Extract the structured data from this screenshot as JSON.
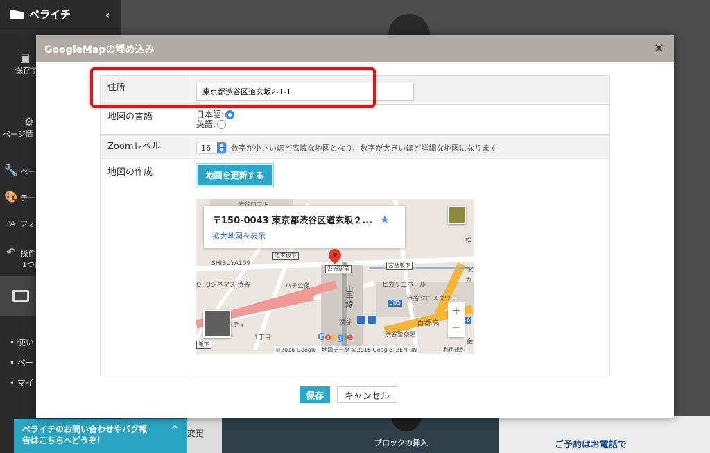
{
  "app": {
    "brand": "ペライチ",
    "sidebar": {
      "save_label": "保存す",
      "page_info_label": "ページ情",
      "page_label": "ペー",
      "theme_label": "テー",
      "font_label": "フォ",
      "undo_label": "操作",
      "undo_sub": "1つ戻",
      "bullets": [
        "使い",
        "ペー",
        "マイ"
      ]
    },
    "bottom": {
      "change_label": "変更",
      "block_insert": "ブロックの挿入",
      "reserve_text": "ご予約はお電話で"
    },
    "support": {
      "line1": "ペライチのお問い合わせやバグ報",
      "line2": "告はこちらへどうぞ！"
    }
  },
  "modal": {
    "title": "GoogleMapの埋め込み",
    "close_icon": "×",
    "address": {
      "label": "住所",
      "value": "東京都渋谷区道玄坂2-1-1"
    },
    "language": {
      "label": "地図の言語",
      "options": [
        {
          "label": "日本語:",
          "selected": true
        },
        {
          "label": "英語:",
          "selected": false
        }
      ]
    },
    "zoom": {
      "label": "Zoomレベル",
      "value": "16",
      "note": "数字が小さいほど広域な地図となり、数字が大きいほど詳細な地図になります"
    },
    "map_create": {
      "label": "地図の作成",
      "update_button": "地図を更新する"
    },
    "map": {
      "info_title": "〒150-0043 東京都渋谷区道玄坂２...",
      "info_link": "拡大地図を表示",
      "labels": {
        "shibuya": "渋谷",
        "shibuya109": "SHIBUYA109",
        "dogenzaka": "道玄坂下",
        "shibuya_station": "渋谷駅前",
        "miyamasuzaka": "宮益坂下",
        "hikarie": "ヒカリエホール",
        "cinema": "OHOシネマズ 渋谷",
        "hachiko": "ハチ公像",
        "yamanote": "山手線",
        "cross_tower": "渋谷クロスタワー",
        "shuto": "首都高",
        "police": "渋谷警察署",
        "chome": "1丁目",
        "city": "ンティ",
        "sakashita": "坂下",
        "num305": "305",
        "num246": "246",
        "matsu": "松",
        "tk": "TK",
        "ka": "カ",
        "shibuya_small": "渋谷",
        "kin": "金",
        "shibuya_loft": "渋谷ロフト"
      },
      "zoom_in": "+",
      "zoom_out": "−",
      "google": "Google",
      "copyright": "©2016 Google - 地図データ ©2016 Google, ZENRIN",
      "terms": "利用規約"
    },
    "save_button": "保存",
    "cancel_button": "キャンセル"
  }
}
